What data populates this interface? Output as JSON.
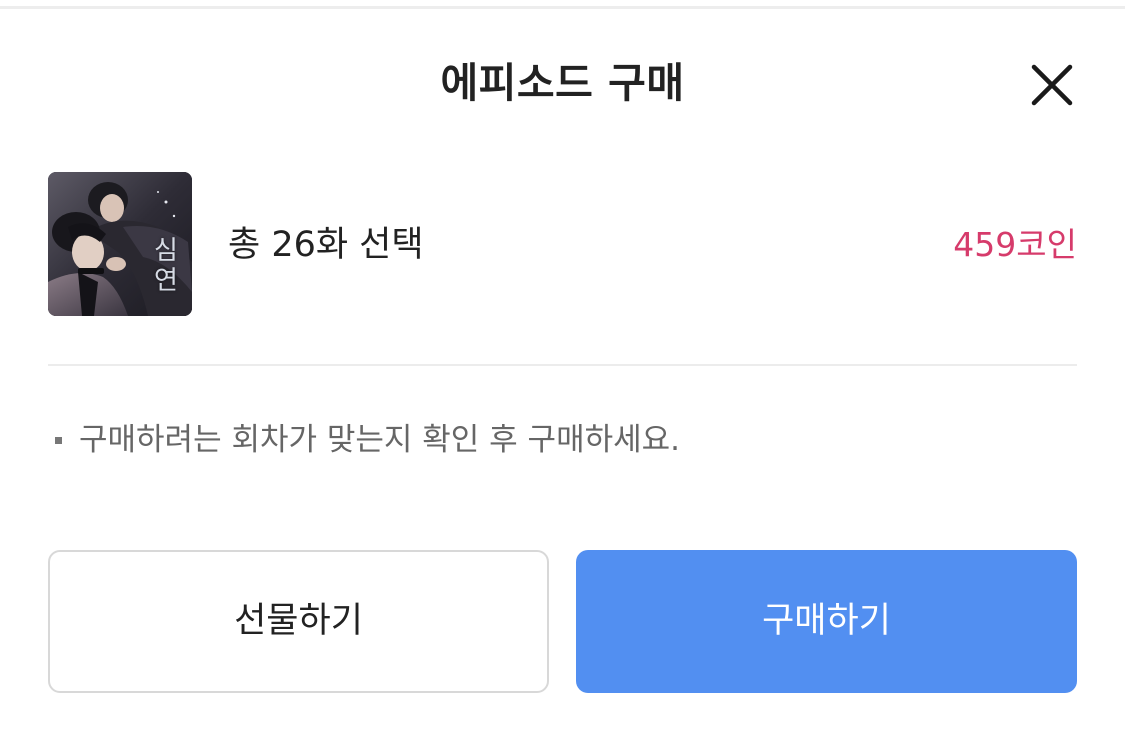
{
  "header": {
    "title": "에피소드 구매",
    "close_icon": "close-icon"
  },
  "episode": {
    "thumbnail_title": "심연",
    "selection_label": "총 26화 선택",
    "price_label": "459코인",
    "price_color": "#d63b6b"
  },
  "notice": {
    "text": "구매하려는 회차가 맞는지 확인 후 구매하세요."
  },
  "buttons": {
    "gift_label": "선물하기",
    "buy_label": "구매하기",
    "buy_color": "#528ff1"
  }
}
